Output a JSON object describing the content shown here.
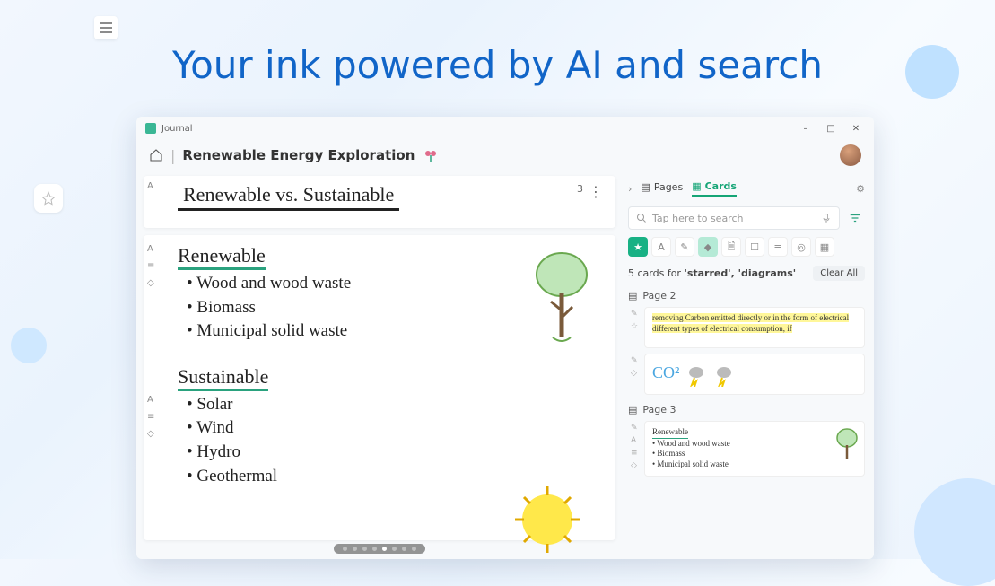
{
  "headline": "Your ink powered by AI and search",
  "titlebar": {
    "app_name": "Journal"
  },
  "window_controls": {
    "minimize": "–",
    "maximize": "□",
    "close": "✕"
  },
  "header": {
    "journal_title": "Renewable Energy Exploration"
  },
  "canvas": {
    "page_count": "3",
    "title": "Renewable vs. Sustainable",
    "section1_heading": "Renewable",
    "section1_items": [
      "Wood and wood waste",
      "Biomass",
      "Municipal solid waste"
    ],
    "section2_heading": "Sustainable",
    "section2_items": [
      "Solar",
      "Wind",
      "Hydro",
      "Geothermal"
    ]
  },
  "side": {
    "tab_pages": "Pages",
    "tab_cards": "Cards",
    "search_placeholder": "Tap here to search",
    "chips": [
      "star",
      "text",
      "pen",
      "shape",
      "doc",
      "note",
      "list",
      "img",
      "cal"
    ],
    "results_text_prefix": "5 cards for ",
    "results_terms": "'starred', 'diagrams'",
    "clear_all": "Clear All",
    "page2_label": "Page 2",
    "page3_label": "Page 3",
    "thumb1_text": "removing Carbon emitted directly or in the form of electrical different types of electrical consumption, if",
    "thumb2_co2": "CO²",
    "thumb3_heading": "Renewable",
    "thumb3_items": [
      "Wood and wood waste",
      "Biomass",
      "Municipal solid waste"
    ]
  }
}
